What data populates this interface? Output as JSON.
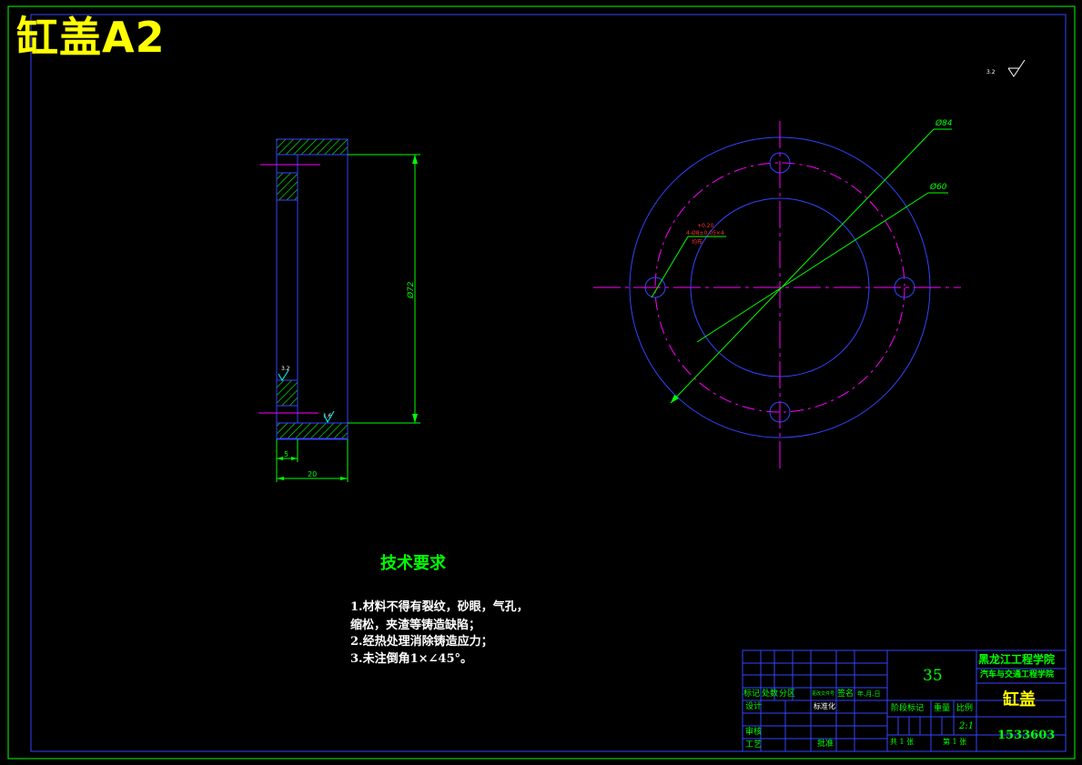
{
  "drawing": {
    "title": "缸盖A2"
  },
  "surface_finish": {
    "top_right_value": "3.2",
    "inner_value": "3.2",
    "bottom_value": "1.6"
  },
  "section_view": {
    "dim_diameter": "Ø72",
    "dim_width_small": "5",
    "dim_width_total": "20"
  },
  "front_view": {
    "dim_outer": "Ø84",
    "dim_pcd": "Ø60",
    "hole_callout_tol": "+0.20",
    "hole_callout_main": "4-Ø8±0.05×4",
    "hole_callout_note": "均布"
  },
  "tech_requirements": {
    "title": "技术要求",
    "lines": [
      "1.材料不得有裂纹，砂眼，气孔，",
      "缩松，夹渣等铸造缺陷；",
      "2.经热处理消除铸造应力；",
      "3.未注倒角1×∠45°。"
    ]
  },
  "title_block": {
    "material": "35",
    "school": "黑龙江工程学院",
    "department": "汽车与交通工程学院",
    "part_name": "缸盖",
    "drawing_number": "1533603",
    "scale_value": "2:1",
    "header_labels": [
      "标记",
      "处数",
      "分区",
      "更改文件号",
      "签名",
      "年.月.日"
    ],
    "design_label": "设计",
    "standardize_label": "标准化",
    "review_label": "审核",
    "process_label": "工艺",
    "approve_label": "批准",
    "stage_label": "阶段标记",
    "weight_label": "重量",
    "scale_label": "比例",
    "total_sheets": "共 1 张",
    "sheet_no": "第 1 张"
  }
}
